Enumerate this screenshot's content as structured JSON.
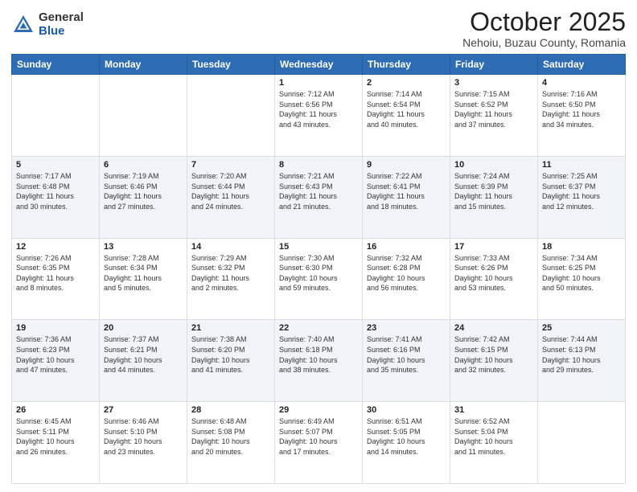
{
  "logo": {
    "general": "General",
    "blue": "Blue"
  },
  "header": {
    "month": "October 2025",
    "location": "Nehoiu, Buzau County, Romania"
  },
  "weekdays": [
    "Sunday",
    "Monday",
    "Tuesday",
    "Wednesday",
    "Thursday",
    "Friday",
    "Saturday"
  ],
  "weeks": [
    [
      {
        "day": "",
        "info": ""
      },
      {
        "day": "",
        "info": ""
      },
      {
        "day": "",
        "info": ""
      },
      {
        "day": "1",
        "info": "Sunrise: 7:12 AM\nSunset: 6:56 PM\nDaylight: 11 hours\nand 43 minutes."
      },
      {
        "day": "2",
        "info": "Sunrise: 7:14 AM\nSunset: 6:54 PM\nDaylight: 11 hours\nand 40 minutes."
      },
      {
        "day": "3",
        "info": "Sunrise: 7:15 AM\nSunset: 6:52 PM\nDaylight: 11 hours\nand 37 minutes."
      },
      {
        "day": "4",
        "info": "Sunrise: 7:16 AM\nSunset: 6:50 PM\nDaylight: 11 hours\nand 34 minutes."
      }
    ],
    [
      {
        "day": "5",
        "info": "Sunrise: 7:17 AM\nSunset: 6:48 PM\nDaylight: 11 hours\nand 30 minutes."
      },
      {
        "day": "6",
        "info": "Sunrise: 7:19 AM\nSunset: 6:46 PM\nDaylight: 11 hours\nand 27 minutes."
      },
      {
        "day": "7",
        "info": "Sunrise: 7:20 AM\nSunset: 6:44 PM\nDaylight: 11 hours\nand 24 minutes."
      },
      {
        "day": "8",
        "info": "Sunrise: 7:21 AM\nSunset: 6:43 PM\nDaylight: 11 hours\nand 21 minutes."
      },
      {
        "day": "9",
        "info": "Sunrise: 7:22 AM\nSunset: 6:41 PM\nDaylight: 11 hours\nand 18 minutes."
      },
      {
        "day": "10",
        "info": "Sunrise: 7:24 AM\nSunset: 6:39 PM\nDaylight: 11 hours\nand 15 minutes."
      },
      {
        "day": "11",
        "info": "Sunrise: 7:25 AM\nSunset: 6:37 PM\nDaylight: 11 hours\nand 12 minutes."
      }
    ],
    [
      {
        "day": "12",
        "info": "Sunrise: 7:26 AM\nSunset: 6:35 PM\nDaylight: 11 hours\nand 8 minutes."
      },
      {
        "day": "13",
        "info": "Sunrise: 7:28 AM\nSunset: 6:34 PM\nDaylight: 11 hours\nand 5 minutes."
      },
      {
        "day": "14",
        "info": "Sunrise: 7:29 AM\nSunset: 6:32 PM\nDaylight: 11 hours\nand 2 minutes."
      },
      {
        "day": "15",
        "info": "Sunrise: 7:30 AM\nSunset: 6:30 PM\nDaylight: 10 hours\nand 59 minutes."
      },
      {
        "day": "16",
        "info": "Sunrise: 7:32 AM\nSunset: 6:28 PM\nDaylight: 10 hours\nand 56 minutes."
      },
      {
        "day": "17",
        "info": "Sunrise: 7:33 AM\nSunset: 6:26 PM\nDaylight: 10 hours\nand 53 minutes."
      },
      {
        "day": "18",
        "info": "Sunrise: 7:34 AM\nSunset: 6:25 PM\nDaylight: 10 hours\nand 50 minutes."
      }
    ],
    [
      {
        "day": "19",
        "info": "Sunrise: 7:36 AM\nSunset: 6:23 PM\nDaylight: 10 hours\nand 47 minutes."
      },
      {
        "day": "20",
        "info": "Sunrise: 7:37 AM\nSunset: 6:21 PM\nDaylight: 10 hours\nand 44 minutes."
      },
      {
        "day": "21",
        "info": "Sunrise: 7:38 AM\nSunset: 6:20 PM\nDaylight: 10 hours\nand 41 minutes."
      },
      {
        "day": "22",
        "info": "Sunrise: 7:40 AM\nSunset: 6:18 PM\nDaylight: 10 hours\nand 38 minutes."
      },
      {
        "day": "23",
        "info": "Sunrise: 7:41 AM\nSunset: 6:16 PM\nDaylight: 10 hours\nand 35 minutes."
      },
      {
        "day": "24",
        "info": "Sunrise: 7:42 AM\nSunset: 6:15 PM\nDaylight: 10 hours\nand 32 minutes."
      },
      {
        "day": "25",
        "info": "Sunrise: 7:44 AM\nSunset: 6:13 PM\nDaylight: 10 hours\nand 29 minutes."
      }
    ],
    [
      {
        "day": "26",
        "info": "Sunrise: 6:45 AM\nSunset: 5:11 PM\nDaylight: 10 hours\nand 26 minutes."
      },
      {
        "day": "27",
        "info": "Sunrise: 6:46 AM\nSunset: 5:10 PM\nDaylight: 10 hours\nand 23 minutes."
      },
      {
        "day": "28",
        "info": "Sunrise: 6:48 AM\nSunset: 5:08 PM\nDaylight: 10 hours\nand 20 minutes."
      },
      {
        "day": "29",
        "info": "Sunrise: 6:49 AM\nSunset: 5:07 PM\nDaylight: 10 hours\nand 17 minutes."
      },
      {
        "day": "30",
        "info": "Sunrise: 6:51 AM\nSunset: 5:05 PM\nDaylight: 10 hours\nand 14 minutes."
      },
      {
        "day": "31",
        "info": "Sunrise: 6:52 AM\nSunset: 5:04 PM\nDaylight: 10 hours\nand 11 minutes."
      },
      {
        "day": "",
        "info": ""
      }
    ]
  ]
}
